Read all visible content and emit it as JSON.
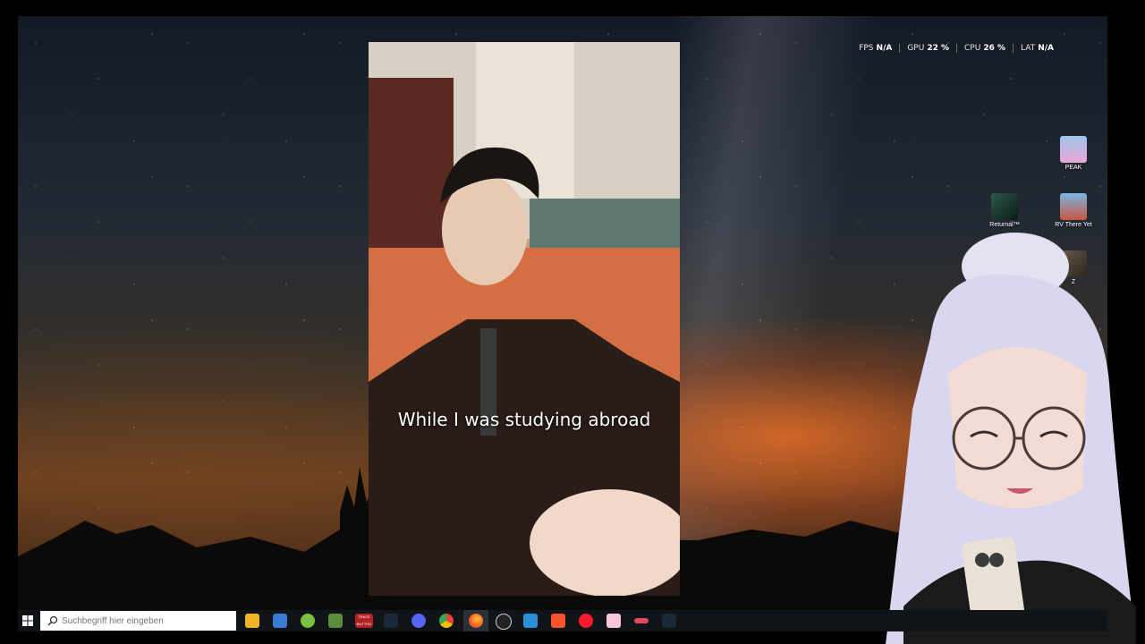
{
  "performance": {
    "fps_label": "FPS",
    "fps_value": "N/A",
    "gpu_label": "GPU",
    "gpu_value": "22 %",
    "cpu_label": "CPU",
    "cpu_value": "26 %",
    "lat_label": "LAT",
    "lat_value": "N/A"
  },
  "desktop_icons": {
    "peak": "PEAK",
    "returnal": "Returnal™",
    "rv_there_yet": "RV There Yet",
    "partial_label": "Z"
  },
  "video": {
    "subtitle": "While I was studying abroad"
  },
  "taskbar": {
    "search_placeholder": "Suchbegriff hier eingeben",
    "apps": [
      "file-explorer",
      "microsoft-store",
      "android-app",
      "minecraft",
      "trace-button",
      "steam",
      "discord",
      "chrome",
      "firefox",
      "obs",
      "app-blue",
      "brave",
      "opera",
      "pink-app",
      "app-red",
      "steam-2"
    ],
    "trace_label": "TRACE BUTTON"
  },
  "colors": {
    "taskbar_bg": "#101318",
    "subtitle": "#ffffff"
  }
}
